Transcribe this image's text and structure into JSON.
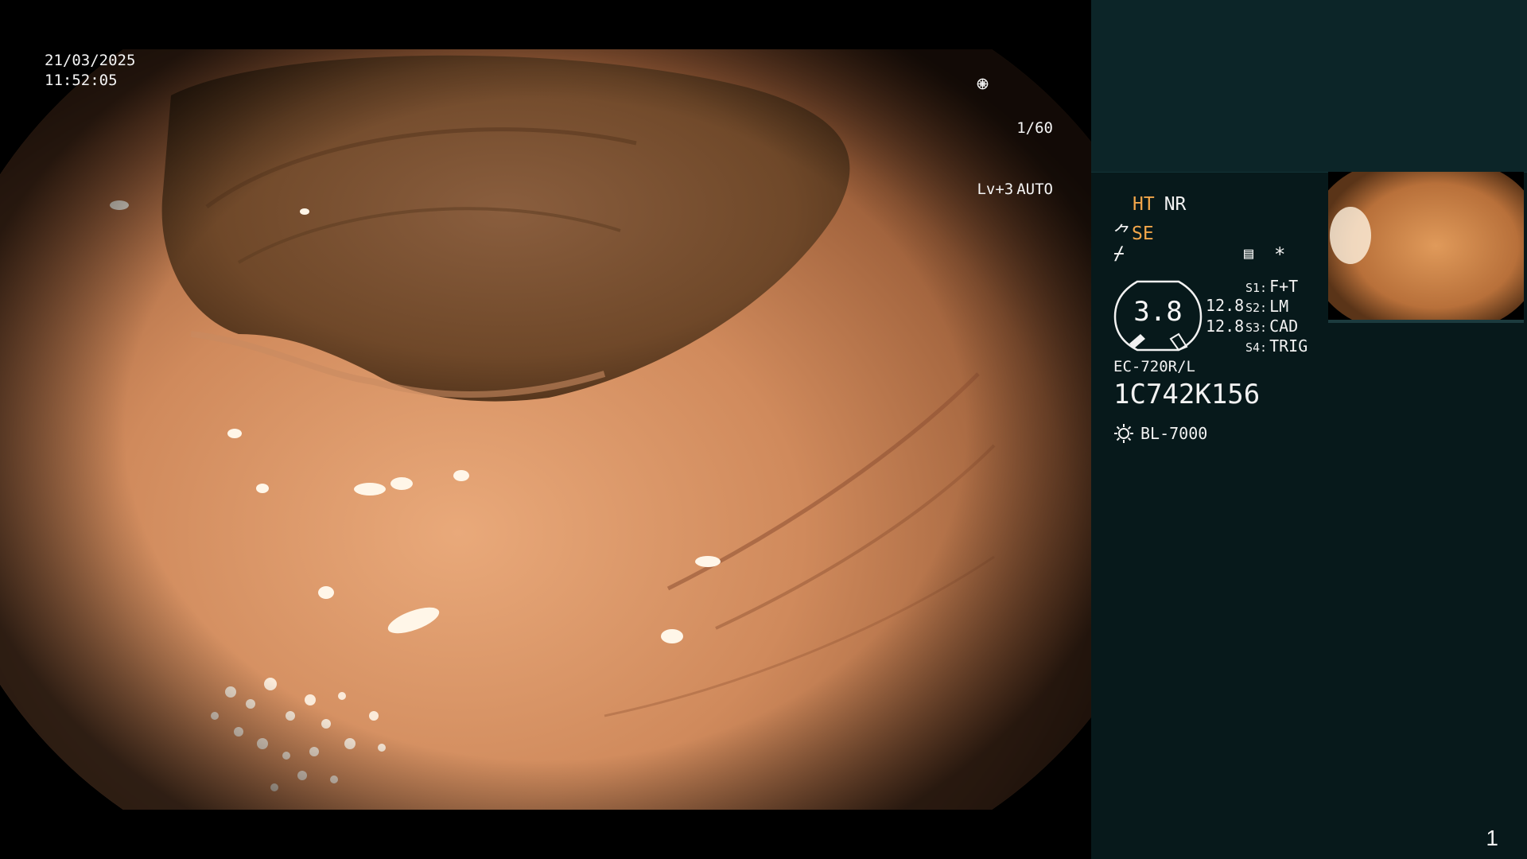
{
  "overlay": {
    "date": "21/03/2025",
    "time": "11:52:05",
    "shutter": "1/60",
    "level": "Lv+3",
    "exposure_mode": "AUTO"
  },
  "panel": {
    "mode_ht": "HT",
    "mode_nr": "NR",
    "mode_se": "SE",
    "zoom_value": "3.8",
    "scale_a": "12.8",
    "scale_b": "12.8",
    "switches": [
      {
        "key": "S1:",
        "value": "F+T"
      },
      {
        "key": "S2:",
        "value": "LM"
      },
      {
        "key": "S3:",
        "value": "CAD"
      },
      {
        "key": "S4:",
        "value": "TRIG"
      }
    ],
    "scope_model": "EC-720R/L",
    "serial_number": "1C742K156",
    "light_source": "BL-7000",
    "page_number": "1"
  },
  "colors": {
    "panel_bg": "#07191b",
    "panel_header_bg": "#0c2528",
    "accent_orange": "#f2a64a",
    "text_white": "#f2f2f2"
  },
  "icons": {
    "shutter_icon": "aperture-icon",
    "auto_icon": "iris-icon",
    "light_icon": "sun-icon",
    "memo_icon": "memo-icon"
  }
}
